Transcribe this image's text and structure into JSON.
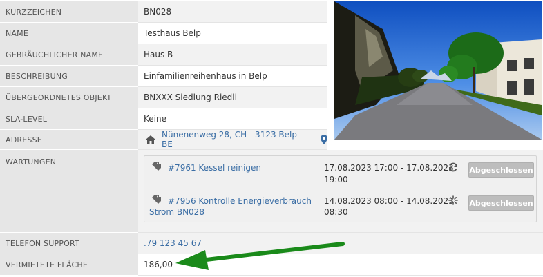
{
  "fields": {
    "kurzzeichen": {
      "label": "KURZZEICHEN",
      "value": "BN028"
    },
    "name": {
      "label": "NAME",
      "value": "Testhaus Belp"
    },
    "gebr_name": {
      "label": "GEBRÄUCHLICHER NAME",
      "value": "Haus B"
    },
    "beschreibung": {
      "label": "BESCHREIBUNG",
      "value": "Einfamilienreihenhaus in Belp"
    },
    "objekt": {
      "label": "ÜBERGEORDNETES OBJEKT",
      "value": "BNXXX Siedlung Riedli"
    },
    "sla": {
      "label": "SLA-LEVEL",
      "value": "Keine"
    },
    "adresse": {
      "label": "ADRESSE",
      "value": "Nünenenweg 28, CH - 3123 Belp - BE"
    },
    "wartungen": {
      "label": "WARTUNGEN"
    },
    "telefon": {
      "label": "TELEFON SUPPORT",
      "value": ".79 123 45 67"
    },
    "flaeche": {
      "label": "VERMIETETE FLÄCHE",
      "value": "186,00"
    }
  },
  "wartungen": [
    {
      "title_line1": "#7961 Kessel reinigen",
      "title_line2": "",
      "date_line1": "17.08.2023 17:00 - 17.08.2023",
      "date_line2": "19:00",
      "status_icon": "refresh-icon",
      "button": "Abgeschlossen"
    },
    {
      "title_line1": "#7956 Kontrolle Energieverbrauch",
      "title_line2": "Strom BN028",
      "date_line1": "14.08.2023 08:00 - 14.08.2023",
      "date_line2": "08:30",
      "status_icon": "spinner-icon",
      "button": "Abgeschlossen"
    }
  ],
  "icons": {
    "address": "home-icon",
    "map": "map-marker-icon",
    "ticket": "tag-icon"
  },
  "colors": {
    "link": "#3b6ea5",
    "label_bg": "#e6e6e6",
    "button_bg": "#bdbdbd",
    "arrow": "#1a8a1a"
  }
}
